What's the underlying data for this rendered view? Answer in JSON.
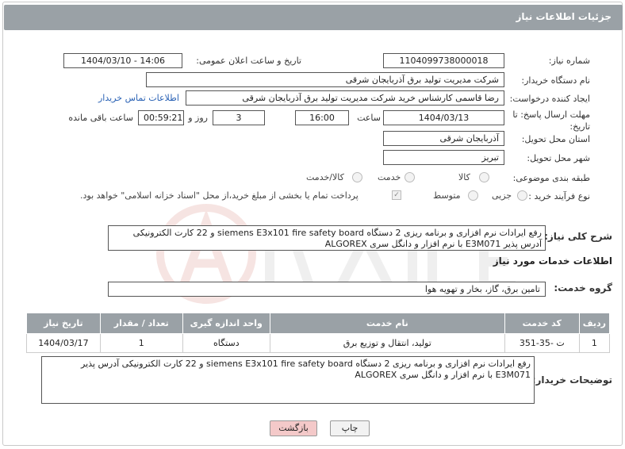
{
  "header": {
    "title": "جزئیات اطلاعات نیاز"
  },
  "fields": {
    "need_number_label": "شماره نیاز:",
    "need_number": "1104099738000018",
    "announce_label": "تاریخ و ساعت اعلان عمومی:",
    "announce_value": "1404/03/10 - 14:06",
    "buyer_org_label": "نام دستگاه خریدار:",
    "buyer_org": "شرکت مدیریت تولید برق آذربایجان شرقی",
    "requester_label": "ایجاد کننده درخواست:",
    "requester": "رضا قاسمی کارشناس خرید شرکت مدیریت تولید برق آذربایجان شرقی",
    "buyer_contact_link": "اطلاعات تماس خریدار",
    "deadline_label": "مهلت ارسال پاسخ: تا تاریخ:",
    "deadline_date": "1404/03/13",
    "time_label": "ساعت",
    "deadline_time": "16:00",
    "days_value": "3",
    "days_label": "روز و",
    "remaining_time": "00:59:21",
    "remaining_label": "ساعت باقی مانده",
    "province_label": "استان محل تحویل:",
    "province": "آذربایجان شرقی",
    "city_label": "شهر محل تحویل:",
    "city": "تبریز",
    "category_label": "طبقه بندی موضوعی:",
    "category_options": [
      "کالا",
      "خدمت",
      "کالا/خدمت"
    ],
    "process_label": "نوع فرآیند خرید :",
    "process_options": [
      "جزیی",
      "متوسط"
    ],
    "payment_note": "پرداخت تمام یا بخشی از مبلغ خرید،از محل \"اسناد خزانه اسلامی\" خواهد بود."
  },
  "summary": {
    "label": "شرح کلی نیاز:",
    "text": "رفع ایرادات نرم افزاری و برنامه ریزی 2 دستگاه siemens E3x101 fire safety board و 22 کارت الکترونیکی آدرس پذیر E3M071 با نرم افزار و دانگل سری ALGOREX"
  },
  "services": {
    "title": "اطلاعات خدمات مورد نیاز",
    "group_label": "گروه خدمت:",
    "group_value": "تامین برق، گاز، بخار و تهویه هوا",
    "columns": [
      "ردیف",
      "کد خدمت",
      "نام خدمت",
      "واحد اندازه گیری",
      "تعداد / مقدار",
      "تاریخ نیاز"
    ],
    "rows": [
      [
        "1",
        "ت -35-351",
        "تولید، انتقال و توزیع برق",
        "دستگاه",
        "1",
        "1404/03/17"
      ]
    ]
  },
  "buyer_notes": {
    "label": "توضیحات خریدار:",
    "text": "رفع ایرادات نرم افزاری و برنامه ریزی 2 دستگاه siemens E3x101 fire safety board و 22 کارت الکترونیکی آدرس پذیر E3M071 با نرم افزار و دانگل سری ALGOREX"
  },
  "buttons": {
    "print": "چاپ",
    "back": "بازگشت"
  },
  "colors": {
    "header_bg": "#9aa1a6",
    "link": "#2a62b5",
    "back_button": "#f4c9c9"
  }
}
